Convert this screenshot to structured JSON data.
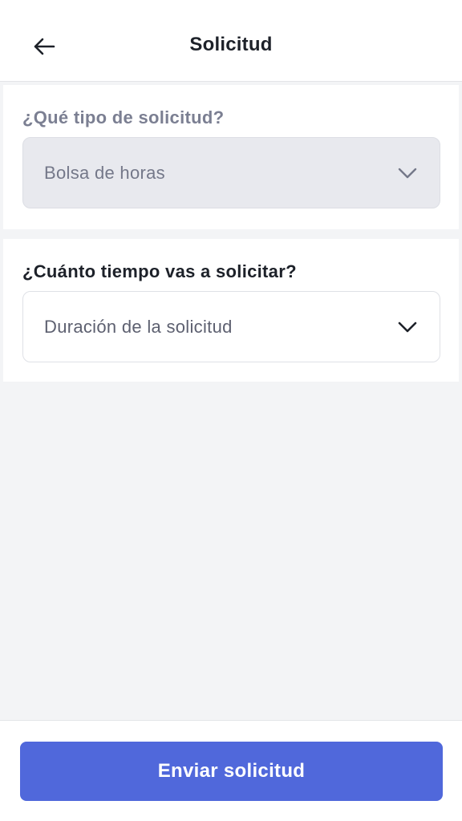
{
  "header": {
    "title": "Solicitud",
    "back_icon": "arrow-left-icon"
  },
  "form": {
    "request_type": {
      "question": "¿Qué tipo de solicitud?",
      "value": "Bolsa de horas",
      "state": "disabled",
      "icon": "chevron-down-icon"
    },
    "duration": {
      "question": "¿Cuánto tiempo vas a solicitar?",
      "placeholder": "Duración de la solicitud",
      "icon": "chevron-down-icon"
    }
  },
  "footer": {
    "submit_label": "Enviar solicitud"
  },
  "colors": {
    "accent": "#5068db",
    "background": "#f3f4f6",
    "disabled_field": "#e8e9ee",
    "muted_text": "#7b7f92",
    "strong_text": "#1d2129"
  }
}
